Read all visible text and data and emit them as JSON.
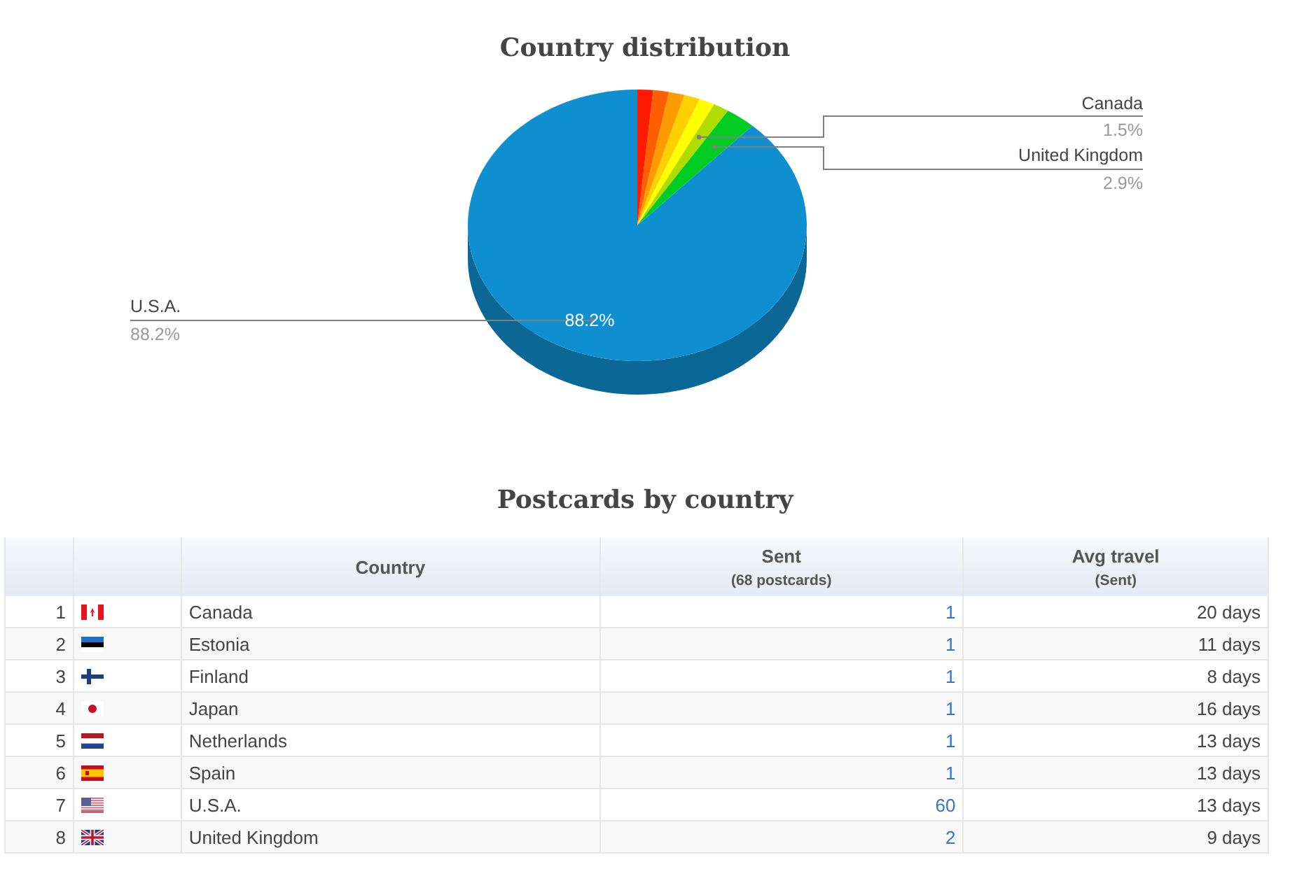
{
  "pie_section": {
    "title": "Country distribution",
    "callouts": [
      {
        "label": "Canada",
        "value": "1.5%"
      },
      {
        "label": "United Kingdom",
        "value": "2.9%"
      },
      {
        "label": "U.S.A.",
        "value": "88.2%",
        "inner_label": "88.2%"
      }
    ]
  },
  "table_section": {
    "title": "Postcards by country",
    "columns": [
      {
        "label": "Country"
      },
      {
        "label": "Sent",
        "sublabel": "(68 postcards)"
      },
      {
        "label": "Avg travel",
        "sublabel": "(Sent)"
      }
    ],
    "rows": [
      {
        "rank": "1",
        "kind": "ca",
        "country": "Canada",
        "sent": "1",
        "avg_travel": "20 days"
      },
      {
        "rank": "2",
        "kind": "ee",
        "country": "Estonia",
        "sent": "1",
        "avg_travel": "11 days"
      },
      {
        "rank": "3",
        "kind": "fi",
        "country": "Finland",
        "sent": "1",
        "avg_travel": "8 days"
      },
      {
        "rank": "4",
        "kind": "jp",
        "country": "Japan",
        "sent": "1",
        "avg_travel": "16 days"
      },
      {
        "rank": "5",
        "kind": "nl",
        "country": "Netherlands",
        "sent": "1",
        "avg_travel": "13 days"
      },
      {
        "rank": "6",
        "kind": "es",
        "country": "Spain",
        "sent": "1",
        "avg_travel": "13 days"
      },
      {
        "rank": "7",
        "kind": "us",
        "country": "U.S.A.",
        "sent": "60",
        "avg_travel": "13 days"
      },
      {
        "rank": "8",
        "kind": "gb",
        "country": "United Kingdom",
        "sent": "2",
        "avg_travel": "9 days"
      }
    ]
  }
}
